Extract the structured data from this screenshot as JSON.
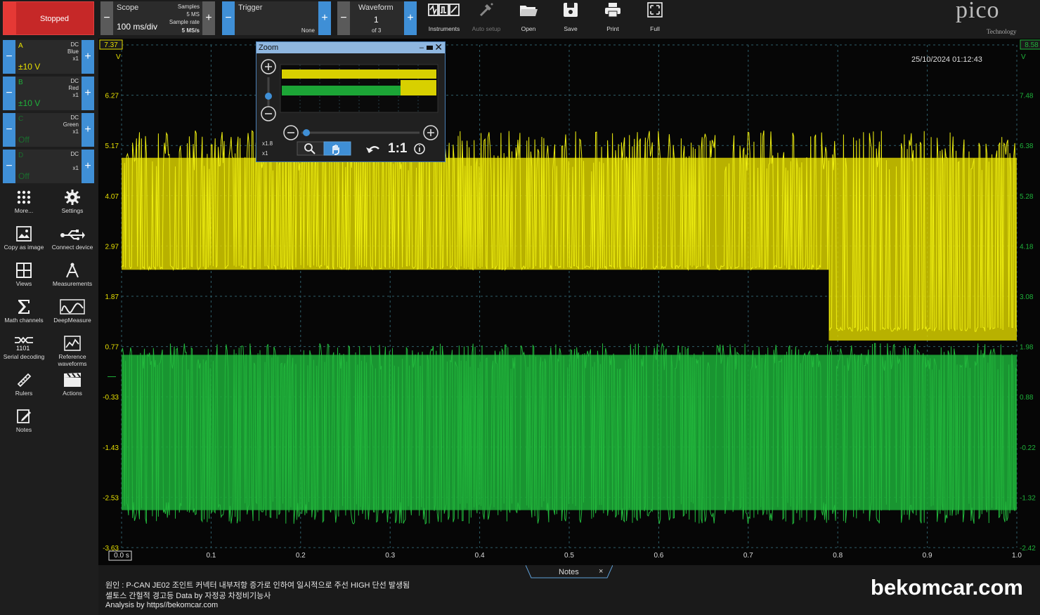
{
  "toolbar": {
    "stop_label": "Stopped",
    "scope": {
      "label": "Scope",
      "timebase": "100 ms/div",
      "samples_label": "Samples",
      "samples_value": "5 MS",
      "rate_label": "Sample rate",
      "rate_value": "5 MS/s"
    },
    "trigger": {
      "label": "Trigger",
      "mode": "None"
    },
    "waveform": {
      "label": "Waveform",
      "index": "1",
      "count": "of 3"
    },
    "buttons": [
      {
        "label": "Instruments",
        "icon": "instruments-icon"
      },
      {
        "label": "Auto setup",
        "icon": "auto-setup-icon"
      },
      {
        "label": "Open",
        "icon": "folder-icon"
      },
      {
        "label": "Save",
        "icon": "save-icon"
      },
      {
        "label": "Print",
        "icon": "print-icon"
      },
      {
        "label": "Full",
        "icon": "fullscreen-icon"
      }
    ],
    "brand": "pico",
    "brand_sub": "Technology"
  },
  "channels": [
    {
      "letter": "A",
      "coupling": "DC",
      "color_name": "Blue",
      "probe": "x1",
      "range": "±10 V",
      "color": "#e8e000"
    },
    {
      "letter": "B",
      "coupling": "DC",
      "color_name": "Red",
      "probe": "x1",
      "range": "±10 V",
      "color": "#1fb13a"
    },
    {
      "letter": "C",
      "coupling": "DC",
      "color_name": "Green",
      "probe": "x1",
      "range": "Off",
      "color": "#1a6e2e"
    },
    {
      "letter": "D",
      "coupling": "DC",
      "color_name": "",
      "probe": "x1",
      "range": "Off",
      "color": "#1a6e2e"
    }
  ],
  "tools": [
    {
      "label": "More...",
      "icon": "grid-dots-icon"
    },
    {
      "label": "Settings",
      "icon": "gear-icon"
    },
    {
      "label": "Copy as image",
      "icon": "image-icon"
    },
    {
      "label": "Connect device",
      "icon": "usb-icon"
    },
    {
      "label": "Views",
      "icon": "views-grid-icon"
    },
    {
      "label": "Measurements",
      "icon": "compass-icon"
    },
    {
      "label": "Math channels",
      "icon": "sigma-icon"
    },
    {
      "label": "DeepMeasure",
      "icon": "deepmeasure-icon"
    },
    {
      "label": "Serial decoding",
      "icon": "serial-decoding-icon"
    },
    {
      "label": "Reference waveforms",
      "icon": "reference-waveforms-icon"
    },
    {
      "label": "Rulers",
      "icon": "ruler-icon"
    },
    {
      "label": "Actions",
      "icon": "clapper-icon"
    },
    {
      "label": "Notes",
      "icon": "notes-icon"
    }
  ],
  "plot": {
    "timestamp": "25/10/2024 01:12:43",
    "left_axis": [
      "7.37",
      "6.27",
      "5.17",
      "4.07",
      "2.97",
      "1.87",
      "0.77",
      "-0.33",
      "-1.43",
      "-2.53",
      "-3.63"
    ],
    "left_unit": "V",
    "right_axis": [
      "8.58",
      "7.48",
      "6.38",
      "5.28",
      "4.18",
      "3.08",
      "1.98",
      "0.88",
      "-0.22",
      "-1.32",
      "-2.42"
    ],
    "right_unit": "V",
    "x_axis": [
      "0.0 s",
      "0.1",
      "0.2",
      "0.3",
      "0.4",
      "0.5",
      "0.6",
      "0.7",
      "0.8",
      "0.9",
      "1.0"
    ],
    "left_axis_color": "#e8e000",
    "right_axis_color": "#1fb13a"
  },
  "zoom": {
    "title": "Zoom",
    "zoom_x": "x1.8",
    "zoom_y": "x1",
    "ratio": "1:1"
  },
  "notes": {
    "tab_label": "Notes",
    "lines": [
      "원인 : P-CAN JE02 조인트 커넥터 내부저항 증가로 인하여 일시적으로 주선 HIGH 단선 발생됨",
      "셀토스 간헐적 경고등 Data by 자정공 차정비기능사",
      "Analysis by  https//bekomcar.com"
    ],
    "watermark": "bekomcar.com"
  }
}
